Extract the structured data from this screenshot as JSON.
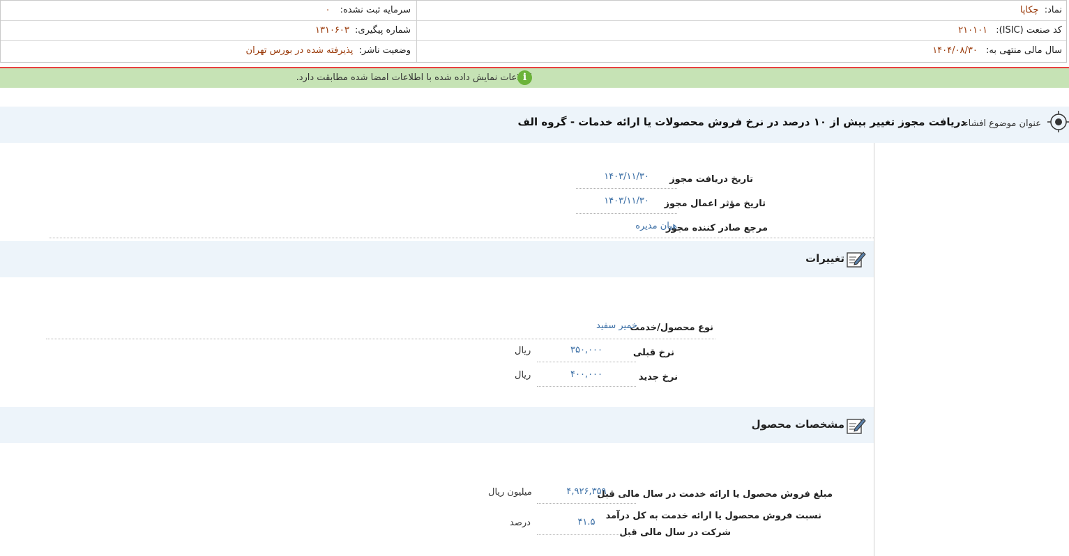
{
  "header": {
    "symbol_label": "نماد:",
    "symbol_value": "چکاپا",
    "unregistered_capital_label": "سرمایه ثبت نشده:",
    "unregistered_capital_value": "۰",
    "isic_label": "کد صنعت (ISIC):",
    "isic_value": "۲۱۰۱۰۱",
    "tracking_label": "شماره پیگیری:",
    "tracking_value": "۱۳۱۰۶۰۳",
    "fiscal_year_label": "سال مالی منتهی به:",
    "fiscal_year_value": "۱۴۰۴/۰۸/۳۰",
    "publisher_status_label": "وضعیت ناشر:",
    "publisher_status_value": "پذیرفته شده در بورس تهران"
  },
  "info_bar": {
    "icon": "info-icon",
    "text": "اطلاعات نمایش داده شده با اطلاعات امضا شده مطابقت دارد."
  },
  "subject": {
    "label": "عنوان موضوع افشاء:",
    "value": "دریافت مجوز تغییر بیش از ۱۰ درصد در نرخ فروش محصولات یا ارائه خدمات - گروه الف"
  },
  "license": {
    "receipt_date_label": "تاریخ دریافت مجوز",
    "receipt_date_value": "۱۴۰۳/۱۱/۳۰",
    "effective_date_label": "تاریخ مؤثر اعمال مجوز",
    "effective_date_value": "۱۴۰۳/۱۱/۳۰",
    "issuer_label": "مرجع صادر کننده مجوز",
    "issuer_value": "هیان مدیره"
  },
  "changes": {
    "title": "تغییرات",
    "product_type_label": "نوع محصول/خدمت",
    "product_type_value": "خمیر سفید",
    "previous_rate_label": "نرخ قبلی",
    "previous_rate_value": "۳۵۰,۰۰۰",
    "previous_rate_unit": "ریال",
    "new_rate_label": "نرخ جدید",
    "new_rate_value": "۴۰۰,۰۰۰",
    "new_rate_unit": "ریال"
  },
  "product_specs": {
    "title": "مشخصات محصول",
    "sales_amount_label": "مبلغ فروش محصول یا ارائه خدمت در سال مالی قبل",
    "sales_amount_value": "۴,۹۲۶,۳۵۹",
    "sales_amount_unit": "میلیون ریال",
    "sales_ratio_label_line1": "نسبت فروش محصول یا ارائه خدمت به کل درآمد",
    "sales_ratio_label_line2": "شرکت در سال مالی قبل",
    "sales_ratio_value": "۴۱.۵",
    "sales_ratio_unit": "درصد"
  },
  "colors": {
    "value_text": "#9a3a0a",
    "link_blue": "#3a6ea5",
    "info_bar_bg": "#c6e3b5",
    "info_icon": "#6bb33a",
    "band_bg": "#edf4fa",
    "red_line": "#e84040"
  }
}
